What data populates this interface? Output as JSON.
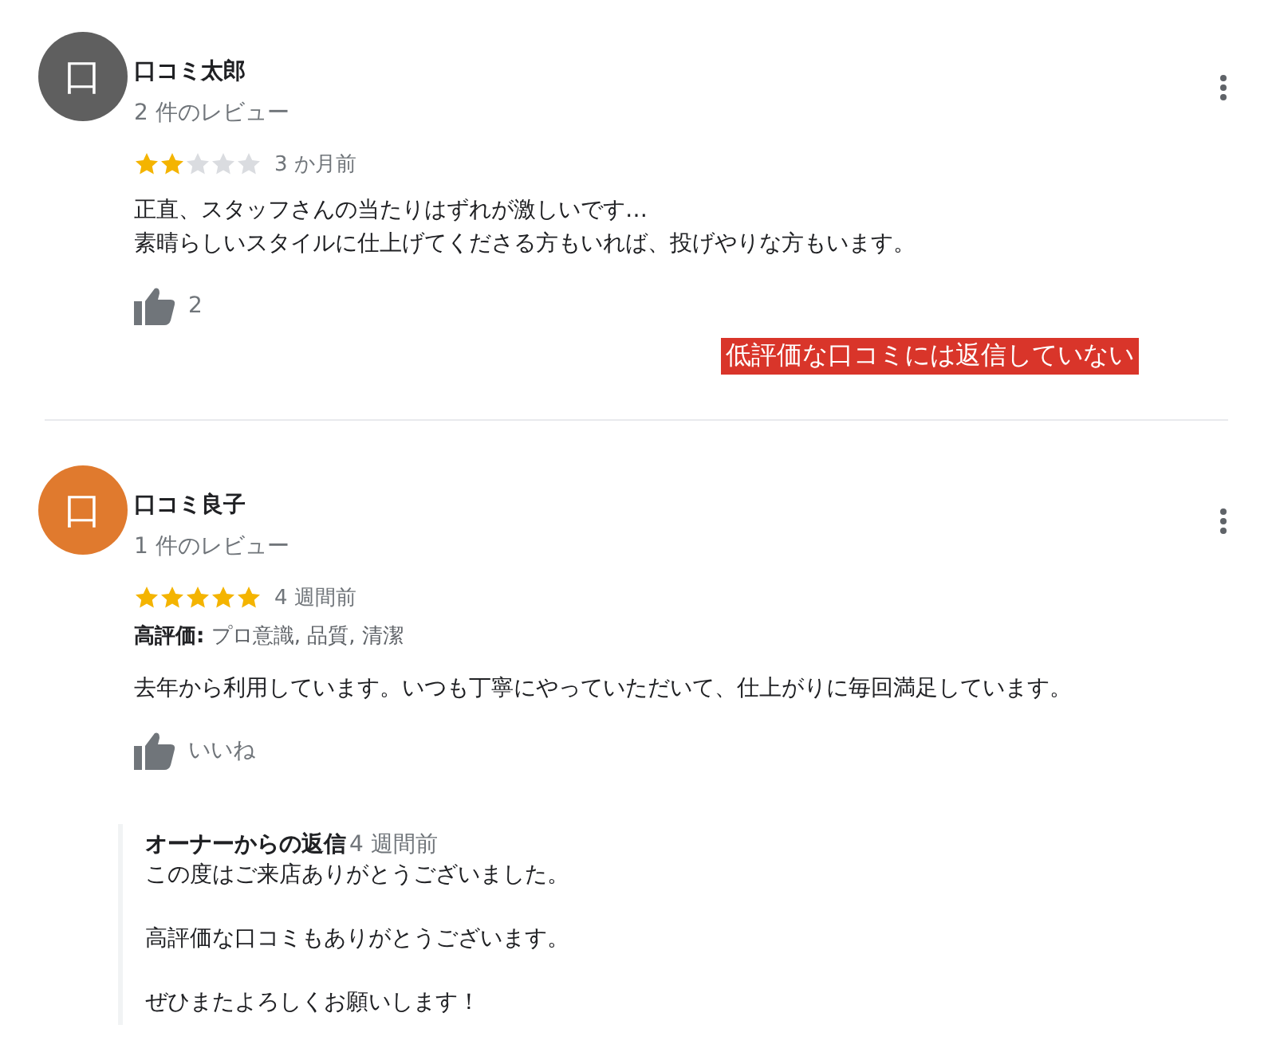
{
  "reviews": [
    {
      "avatar": "口",
      "color": "#5f5f5f",
      "name": "口コミ太郎",
      "review_count": "2 件のレビュー",
      "stars": 2,
      "time": "3 か月前",
      "lines": [
        "正直、スタッフさんの当たりはずれが激しいです…",
        "素晴らしいスタイルに仕上げてくださる方もいれば、投げやりな方もいます。"
      ],
      "likes": "2",
      "annotation": "低評価な口コミには返信していない"
    },
    {
      "avatar": "口",
      "color": "#e07a2e",
      "name": "口コミ良子",
      "review_count": "1 件のレビュー",
      "stars": 5,
      "time": "4 週間前",
      "highlights": {
        "label": "高評価:",
        "text": "プロ意識, 品質, 清潔"
      },
      "lines": [
        "去年から利用しています。いつも丁寧にやっていただいて、仕上がりに毎回満足しています。"
      ],
      "likes": "いいね",
      "reply": {
        "title": "オーナーからの返信",
        "time": "4 週間前",
        "paragraphs": [
          "この度はご来店ありがとうございました。",
          "高評価な口コミもありがとうございます。",
          "ぜひまたよろしくお願いします！"
        ]
      }
    }
  ]
}
